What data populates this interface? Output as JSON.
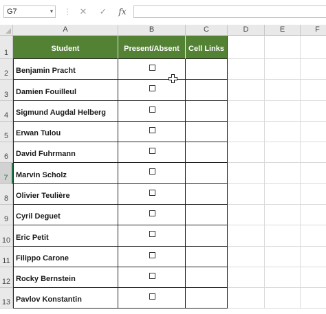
{
  "formula_bar": {
    "name_box": "G7",
    "name_dropdown_icon": "▾",
    "separator": "⋮",
    "cancel_icon": "✕",
    "enter_icon": "✓",
    "fx_label": "fx",
    "formula": ""
  },
  "columns": [
    "A",
    "B",
    "C",
    "D",
    "E",
    "F"
  ],
  "rows": [
    "1",
    "2",
    "3",
    "4",
    "5",
    "6",
    "7",
    "8",
    "9",
    "10",
    "11",
    "12",
    "13"
  ],
  "selected_row": "7",
  "table": {
    "headers": [
      "Student",
      "Present/Absent",
      "Cell Links"
    ],
    "header_color": "#548235",
    "students": [
      "Benjamin Pracht",
      "Damien Fouilleul",
      "Sigmund Augdal Helberg",
      "Erwan Tulou",
      "David Fuhrmann",
      "Marvin Scholz",
      "Olivier Teulière",
      "Cyril Deguet",
      "Eric Petit",
      "Filippo Carone",
      "Rocky Bernstein",
      "Pavlov Konstantin"
    ]
  }
}
